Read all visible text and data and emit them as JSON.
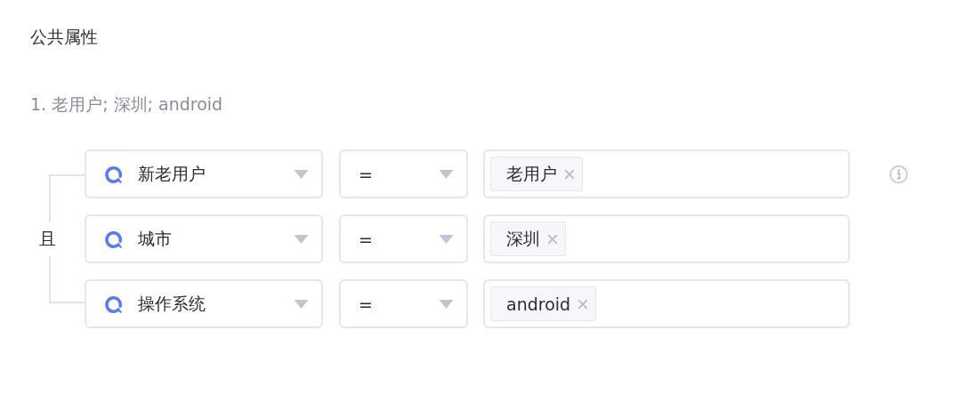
{
  "section_title": "公共属性",
  "rule_summary": "1. 老用户; 深圳; android",
  "connector": "且",
  "conditions": [
    {
      "property": "新老用户",
      "operator": "=",
      "values": [
        "老用户"
      ],
      "info": true
    },
    {
      "property": "城市",
      "operator": "=",
      "values": [
        "深圳"
      ],
      "info": false
    },
    {
      "property": "操作系统",
      "operator": "=",
      "values": [
        "android"
      ],
      "info": false
    }
  ]
}
